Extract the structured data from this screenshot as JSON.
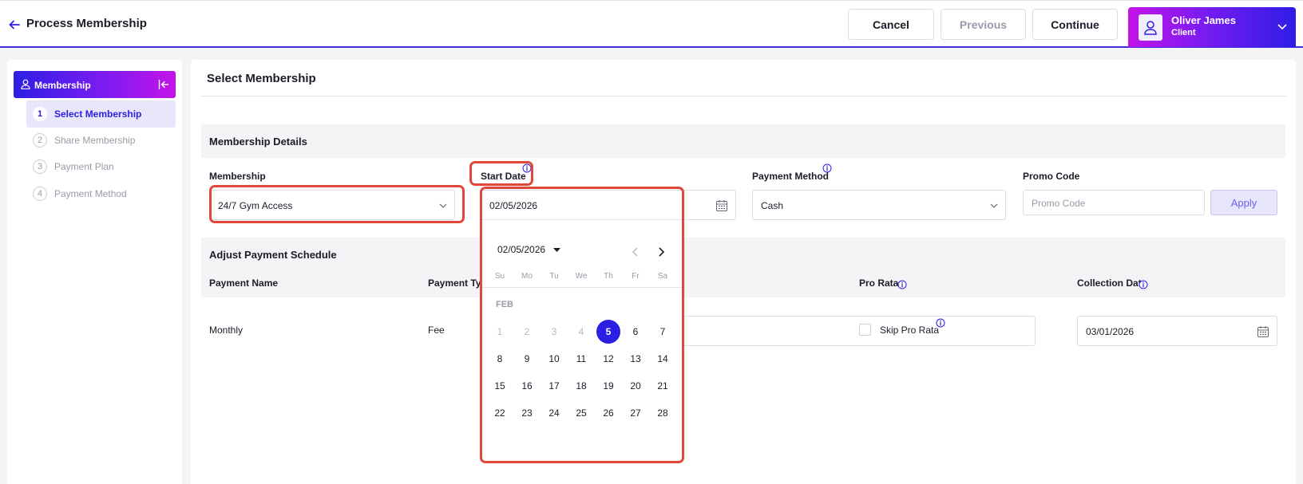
{
  "header": {
    "title": "Process Membership",
    "cancel_label": "Cancel",
    "previous_label": "Previous",
    "continue_label": "Continue",
    "user_name": "Oliver James",
    "user_role": "Client"
  },
  "sidebar": {
    "title": "Membership",
    "items": [
      {
        "num": "1",
        "label": "Select Membership"
      },
      {
        "num": "2",
        "label": "Share Membership"
      },
      {
        "num": "3",
        "label": "Payment Plan"
      },
      {
        "num": "4",
        "label": "Payment Method"
      }
    ]
  },
  "main": {
    "title": "Select Membership",
    "details_section": "Membership Details",
    "membership_label": "Membership",
    "membership_value": "24/7 Gym Access",
    "start_date_label": "Start Date",
    "start_date_value": "02/05/2026",
    "payment_method_label": "Payment Method",
    "payment_method_value": "Cash",
    "promo_label": "Promo Code",
    "promo_placeholder": "Promo Code",
    "apply_label": "Apply",
    "schedule_section": "Adjust Payment Schedule",
    "columns": {
      "payment_name": "Payment Name",
      "payment_type": "Payment Typ",
      "pro_rata": "Pro Rata",
      "collection_date": "Collection Date"
    },
    "row": {
      "payment_name": "Monthly",
      "payment_type": "Fee",
      "skip_pro_rata": "Skip Pro Rata",
      "collection_date": "03/01/2026"
    }
  },
  "calendar": {
    "header_value": "02/05/2026",
    "month_label": "FEB",
    "weekdays": [
      "Su",
      "Mo",
      "Tu",
      "We",
      "Th",
      "Fr",
      "Sa"
    ],
    "weeks": [
      [
        "1",
        "2",
        "3",
        "4",
        "5",
        "6",
        "7"
      ],
      [
        "8",
        "9",
        "10",
        "11",
        "12",
        "13",
        "14"
      ],
      [
        "15",
        "16",
        "17",
        "18",
        "19",
        "20",
        "21"
      ],
      [
        "22",
        "23",
        "24",
        "25",
        "26",
        "27",
        "28"
      ]
    ],
    "selected": "5",
    "disabled_before": "5"
  },
  "colors": {
    "accent": "#2c1fe4",
    "highlight": "#e0493a"
  }
}
